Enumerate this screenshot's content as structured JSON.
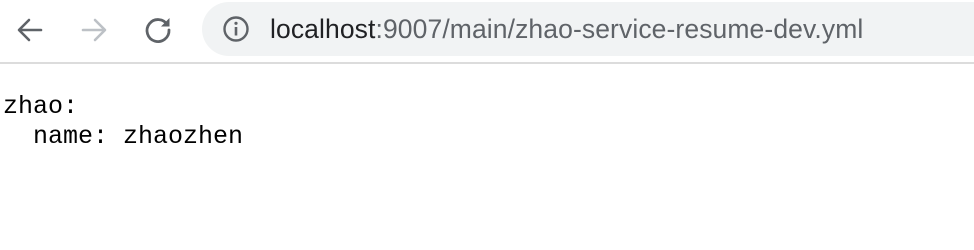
{
  "browser": {
    "back_icon": "arrow-left-icon",
    "forward_icon": "arrow-right-icon",
    "reload_icon": "reload-icon",
    "site_info_icon": "info-circle-icon",
    "address": {
      "host": "localhost",
      "rest": ":9007/main/zhao-service-resume-dev.yml"
    }
  },
  "page": {
    "lines": [
      "zhao:",
      "  name: zhaozhen"
    ]
  }
}
